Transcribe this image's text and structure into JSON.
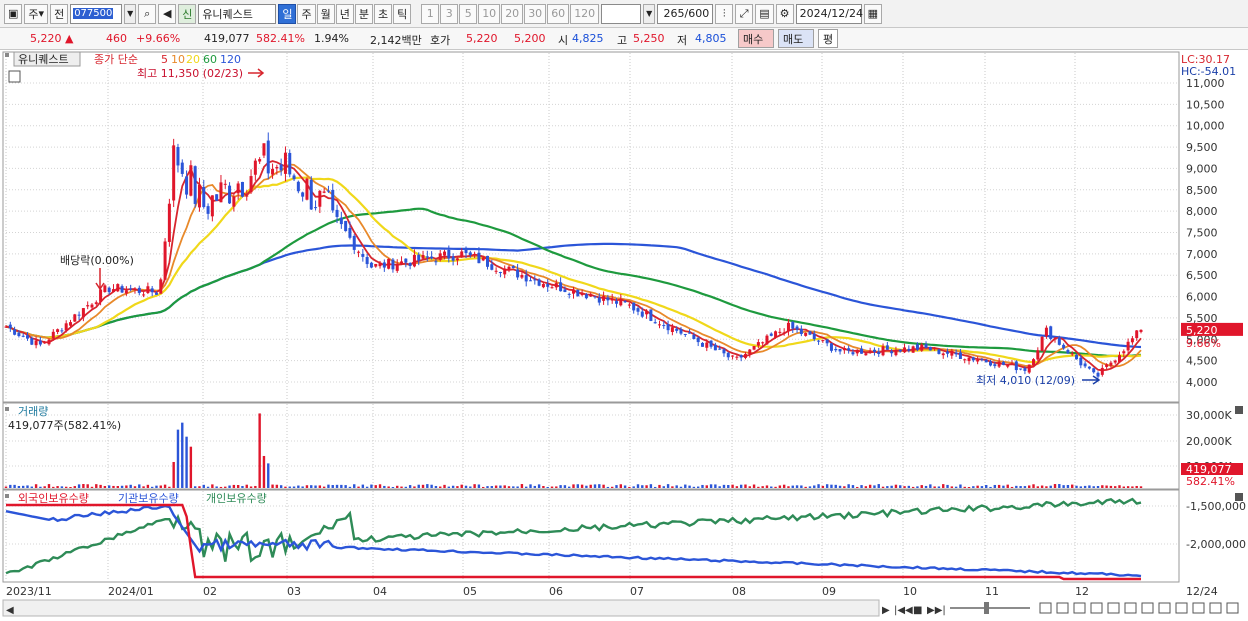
{
  "toolbar": {
    "market_label": "주",
    "prev_label": "전",
    "stock_code": "077500",
    "new_badge": "신",
    "stock_name": "유니퀘스트",
    "periods": [
      "일",
      "주",
      "월",
      "년",
      "분",
      "초",
      "틱"
    ],
    "selected_period": "일",
    "intervals": [
      "1",
      "3",
      "5",
      "10",
      "20",
      "30",
      "60",
      "120"
    ],
    "count_value": "265",
    "count_total": "/600",
    "date": "2024/12/24"
  },
  "quote": {
    "price": "5,220 ▲",
    "change": "460",
    "change_pct": "+9.66%",
    "volume": "419,077",
    "volume_ratio": "582.41%",
    "turnover_pct": "1.94%",
    "amount": "2,142백만",
    "hoga_label": "호가",
    "ask": "5,220",
    "bid": "5,200",
    "open_label": "시",
    "open": "4,825",
    "high_label": "고",
    "high": "5,250",
    "low_label": "저",
    "low": "4,805",
    "buy_label": "매수",
    "sell_label": "매도",
    "flat_label": "평"
  },
  "price_panel": {
    "name_tag": "유니퀘스트",
    "legend_prefix": "종가 단순",
    "ma_periods": [
      "5",
      "10",
      "20",
      "60",
      "120"
    ],
    "ma_colors": [
      "#d7262e",
      "#e8892a",
      "#f0d81a",
      "#1e9a3e",
      "#2b55d8"
    ],
    "high_annotation": "최고 11,350 (02/23)",
    "low_annotation": "최저 4,010 (12/09)",
    "dividend_annotation": "배당락(0.00%)",
    "lc_label": "LC:30.17",
    "hc_label": "HC:-54.01",
    "last_price_tag": "5,220",
    "last_pct_tag": "9.66%"
  },
  "volume_panel": {
    "title": "거래량",
    "current": "419,077주(582.41%)",
    "last_tag": "419,077",
    "last_pct": "582.41%"
  },
  "holding_panel": {
    "legend": [
      "외국인보유수량",
      "기관보유수량",
      "개인보유수량"
    ],
    "colors": [
      "#e0162b",
      "#2b55d8",
      "#2e8b57"
    ]
  },
  "chart_data": {
    "type": "candlestick",
    "price_axis": [
      "11,000",
      "10,500",
      "10,000",
      "9,500",
      "9,000",
      "8,500",
      "8,000",
      "7,500",
      "7,000",
      "6,500",
      "6,000",
      "5,500",
      "5,000",
      "4,500",
      "4,000"
    ],
    "price_ticks": [
      11000,
      10500,
      10000,
      9500,
      9000,
      8500,
      8000,
      7500,
      7000,
      6500,
      6000,
      5500,
      5000,
      4500,
      4000
    ],
    "volume_axis": [
      "30,000K",
      "20,000K",
      "10,000K"
    ],
    "holding_axis": [
      "-1,500,000",
      "-2,000,000"
    ],
    "x_labels": [
      "2023/11",
      "2024/01",
      "02",
      "03",
      "04",
      "05",
      "06",
      "07",
      "08",
      "09",
      "10",
      "11",
      "12",
      "12/24"
    ],
    "high": {
      "value": 11350,
      "date": "02/23"
    },
    "low": {
      "value": 4010,
      "date": "12/09"
    },
    "last": {
      "value": 5220,
      "change_pct": 9.66
    },
    "price_path": [
      [
        "2023/11",
        5300
      ],
      [
        "2023/12",
        4850
      ],
      [
        "2024/01",
        6200
      ],
      [
        "2024/01 late",
        6100
      ],
      [
        "02 early",
        9400
      ],
      [
        "02 mid",
        8100
      ],
      [
        "02/23",
        9100
      ],
      [
        "03 early",
        9000
      ],
      [
        "03 late",
        8000
      ],
      [
        "04",
        6700
      ],
      [
        "05",
        7000
      ],
      [
        "06",
        6300
      ],
      [
        "07",
        5800
      ],
      [
        "08 early",
        4500
      ],
      [
        "08 late",
        5300
      ],
      [
        "09",
        4700
      ],
      [
        "10",
        4800
      ],
      [
        "11",
        4300
      ],
      [
        "11 late",
        5200
      ],
      [
        "12/09",
        4100
      ],
      [
        "12/24",
        5220
      ]
    ]
  },
  "bottom_controls": [
    "◀",
    "▶",
    "|◀◀",
    "■",
    "▶▶|"
  ]
}
